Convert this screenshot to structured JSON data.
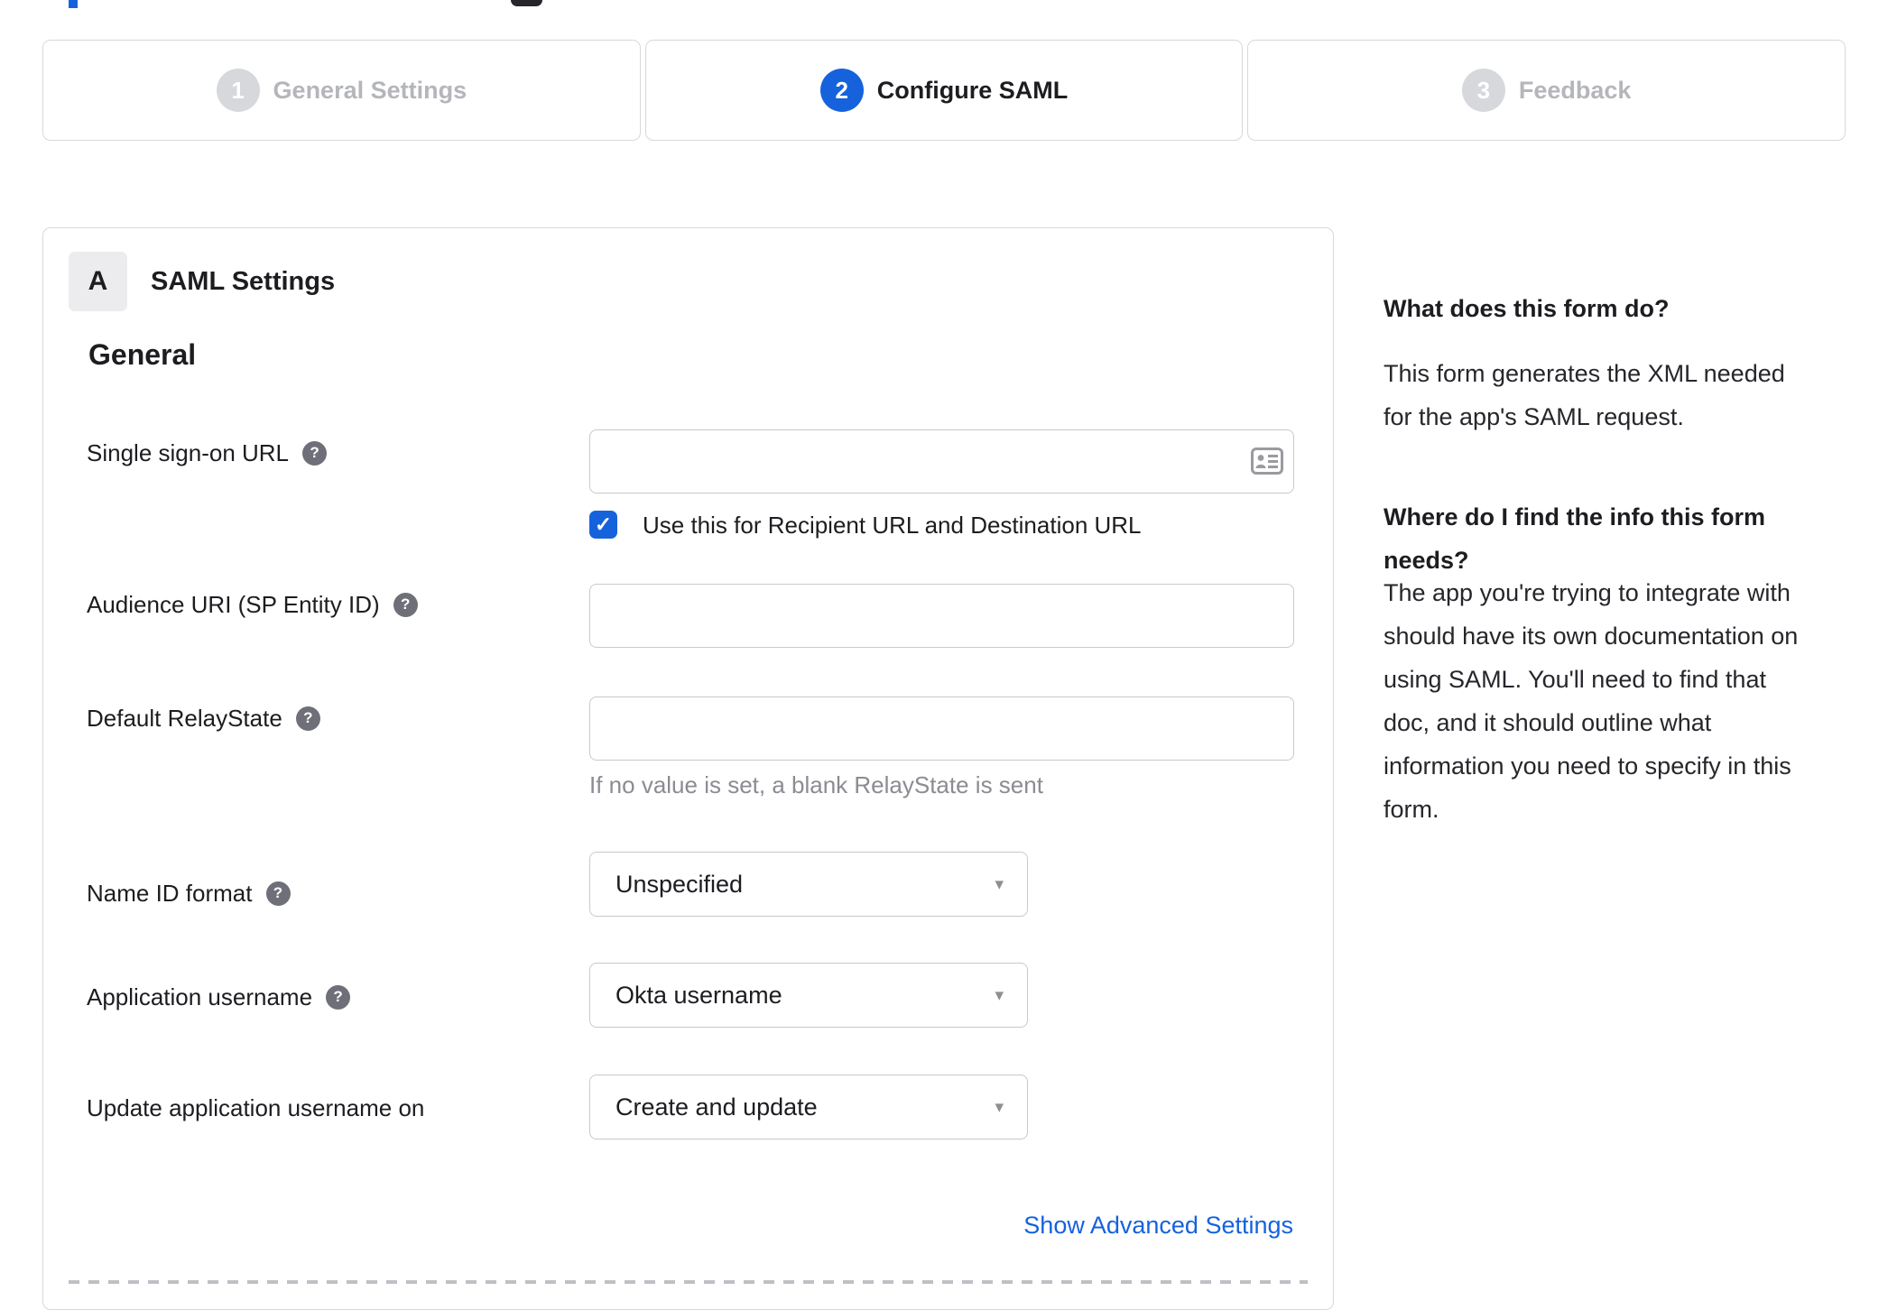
{
  "colors": {
    "accent_blue": "#1662dd",
    "text_dark": "#1d1d21",
    "inactive_gray": "#b4b6bb",
    "circle_gray": "#d6d8db",
    "border_gray": "#d8d8dc",
    "input_border": "#c9c9ce",
    "hint_gray": "#8b8b93",
    "help_icon_gray": "#6f6f79",
    "badge_bg": "#ececee"
  },
  "stepper": {
    "steps": [
      {
        "number": "1",
        "label": "General Settings",
        "active": false
      },
      {
        "number": "2",
        "label": "Configure SAML",
        "active": true
      },
      {
        "number": "3",
        "label": "Feedback",
        "active": false
      }
    ]
  },
  "panel": {
    "badge": "A",
    "title": "SAML Settings",
    "section_heading": "General",
    "fields": {
      "sso": {
        "label": "Single sign-on URL",
        "value": ""
      },
      "sso_checkbox": {
        "label": "Use this for Recipient URL and Destination URL",
        "checked": true
      },
      "audience": {
        "label": "Audience URI (SP Entity ID)",
        "value": ""
      },
      "relay_state": {
        "label": "Default RelayState",
        "value": "",
        "hint": "If no value is set, a blank RelayState is sent"
      },
      "name_id_format": {
        "label": "Name ID format",
        "selected": "Unspecified"
      },
      "application_username": {
        "label": "Application username",
        "selected": "Okta username"
      },
      "update_app_username": {
        "label": "Update application username on",
        "selected": "Create and update"
      }
    },
    "advanced_link": "Show Advanced Settings"
  },
  "sidebar": {
    "q1": "What does this form do?",
    "a1_lines": [
      "This form generates the XML needed",
      "for the app's SAML request."
    ],
    "q2_lines": [
      "Where do I find the info this form",
      "needs?"
    ],
    "a2_lines": [
      "The app you're trying to integrate with",
      "should have its own documentation on",
      "using SAML. You'll need to find that",
      "doc, and it should outline what",
      "information you need to specify in this",
      "form."
    ]
  },
  "icons": {
    "help": "?",
    "caret": "▾",
    "check": "✓"
  }
}
